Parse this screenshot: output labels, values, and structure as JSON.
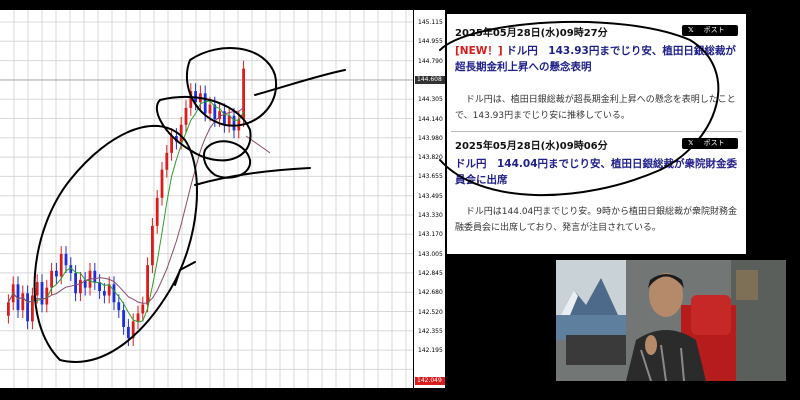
{
  "price_axis": {
    "ticks": [
      "145.115",
      "144.955",
      "144.790",
      "144.465",
      "144.305",
      "144.140",
      "143.980",
      "143.820",
      "143.655",
      "143.495",
      "143.330",
      "143.170",
      "143.005",
      "142.845",
      "142.680",
      "142.520",
      "142.355",
      "142.195"
    ],
    "current_price": "144.608",
    "bottom_price": "142.049"
  },
  "news": [
    {
      "date": "2025年05月28日(水)09時27分",
      "post_label": "ポスト",
      "tag": "[NEW！]",
      "title": "ドル円　143.93円までじり安、植田日銀総裁が超長期金利上昇への懸念表明",
      "body": "ドル円は、植田日銀総裁が超長期金利上昇への懸念を表明したことで、143.93円までじり安に推移している。"
    },
    {
      "date": "2025年05月28日(水)09時06分",
      "post_label": "ポスト",
      "title": "ドル円　144.04円までじり安、植田日銀総裁が衆院財金委員会に出席",
      "body": "ドル円は144.04円までじり安。9時から植田日銀総裁が衆院財務金融委員会に出席しており、発言が注目されている。"
    }
  ],
  "colors": {
    "bull_candle": "#d91d1d",
    "bear_candle": "#1d2fd9",
    "ma_fast": "#2ca02c",
    "ma_slow": "#8b4a6b",
    "price_marker": "#333333",
    "low_marker": "#d91d1d"
  }
}
